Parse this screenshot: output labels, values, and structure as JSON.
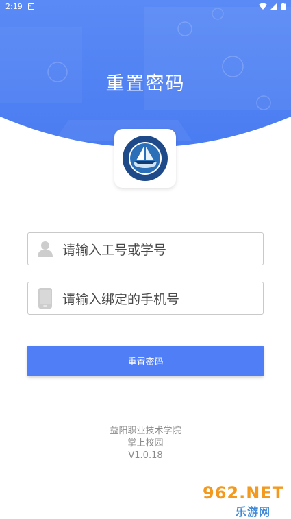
{
  "status_bar": {
    "time": "2:19"
  },
  "header": {
    "title": "重置密码"
  },
  "form": {
    "staff_id_placeholder": "请输入工号或学号",
    "phone_placeholder": "请输入绑定的手机号",
    "submit_label": "重置密码"
  },
  "footer": {
    "school": "益阳职业技术学院",
    "app": "掌上校园",
    "version": "V1.0.18"
  },
  "watermark": {
    "top": "962.NET",
    "bottom": "乐游网"
  },
  "colors": {
    "primary": "#4f7ef7",
    "header": "#4d7ff3"
  },
  "icons": [
    "download-icon",
    "wifi-icon",
    "signal-icon",
    "battery-icon",
    "user-icon",
    "phone-icon",
    "school-logo"
  ]
}
